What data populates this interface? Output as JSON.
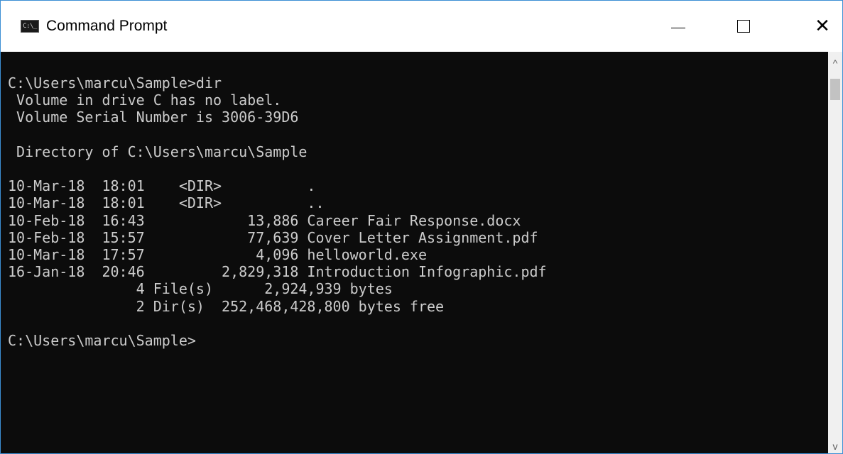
{
  "window": {
    "title": "Command Prompt",
    "icon": "cmd-icon",
    "icon_text": "C:\\_",
    "controls": {
      "minimize": "—",
      "maximize": "□",
      "close": "✕"
    }
  },
  "console": {
    "lines": [
      "C:\\Users\\marcu\\Sample>dir",
      " Volume in drive C has no label.",
      " Volume Serial Number is 3006-39D6",
      "",
      " Directory of C:\\Users\\marcu\\Sample",
      "",
      "10-Mar-18  18:01    <DIR>          .",
      "10-Mar-18  18:01    <DIR>          ..",
      "10-Feb-18  16:43            13,886 Career Fair Response.docx",
      "10-Feb-18  15:57            77,639 Cover Letter Assignment.pdf",
      "10-Mar-18  17:57             4,096 helloworld.exe",
      "16-Jan-18  20:46         2,829,318 Introduction Infographic.pdf",
      "               4 File(s)      2,924,939 bytes",
      "               2 Dir(s)  252,468,428,800 bytes free",
      "",
      "C:\\Users\\marcu\\Sample>"
    ]
  },
  "scrollbar": {
    "up_arrow": "^",
    "down_arrow": "v"
  },
  "colors": {
    "console_background": "#0c0c0c",
    "console_text": "#cccccc",
    "window_border": "#3c8fd4"
  }
}
